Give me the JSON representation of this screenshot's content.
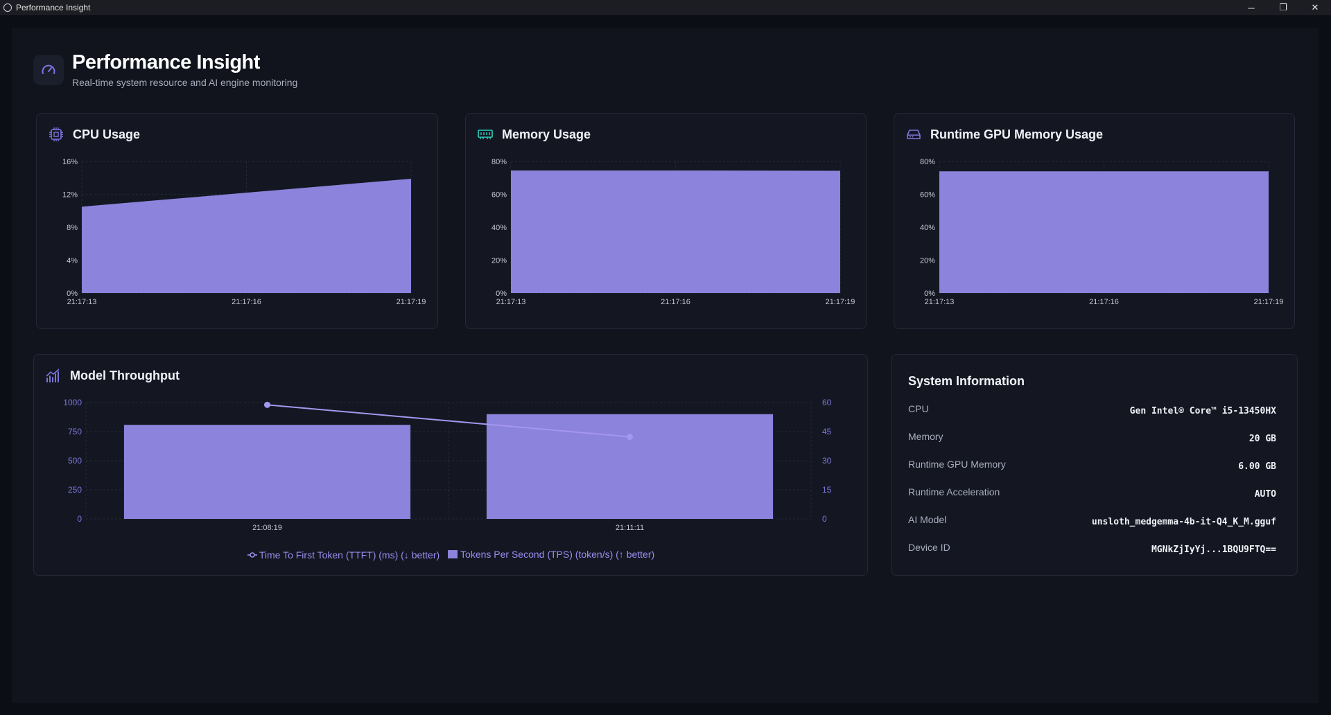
{
  "window": {
    "title": "Performance Insight",
    "minimize": "─",
    "restore": "❐",
    "close": "✕"
  },
  "header": {
    "title": "Performance Insight",
    "subtitle": "Real-time system resource and AI engine monitoring",
    "icon": "gauge-icon"
  },
  "colors": {
    "accent": "#8b83dc",
    "line": "#a596f0",
    "axis_text": "#c6c8d4",
    "right_axis_text": "#7f74e0"
  },
  "cards": {
    "cpu": {
      "title": "CPU Usage",
      "icon": "cpu-icon"
    },
    "memory": {
      "title": "Memory Usage",
      "icon": "memory-icon"
    },
    "gpu": {
      "title": "Runtime GPU Memory Usage",
      "icon": "gpu-memory-icon"
    },
    "throughput": {
      "title": "Model Throughput",
      "icon": "throughput-chart-icon"
    }
  },
  "chart_data": [
    {
      "type": "area",
      "id": "cpu",
      "x": [
        "21:17:13",
        "21:17:16",
        "21:17:19"
      ],
      "values": [
        10.5,
        12.2,
        13.9
      ],
      "ylim": [
        0,
        16
      ],
      "yticks": [
        "0%",
        "4%",
        "8%",
        "12%",
        "16%"
      ],
      "ytick_values": [
        0,
        4,
        8,
        12,
        16
      ],
      "grid": true
    },
    {
      "type": "area",
      "id": "memory",
      "x": [
        "21:17:13",
        "21:17:16",
        "21:17:19"
      ],
      "values": [
        74.5,
        74.5,
        74.3
      ],
      "ylim": [
        0,
        80
      ],
      "yticks": [
        "0%",
        "20%",
        "40%",
        "60%",
        "80%"
      ],
      "ytick_values": [
        0,
        20,
        40,
        60,
        80
      ],
      "grid": true
    },
    {
      "type": "area",
      "id": "gpu",
      "x": [
        "21:17:13",
        "21:17:16",
        "21:17:19"
      ],
      "values": [
        74,
        74,
        74
      ],
      "ylim": [
        0,
        80
      ],
      "yticks": [
        "0%",
        "20%",
        "40%",
        "60%",
        "80%"
      ],
      "ytick_values": [
        0,
        20,
        40,
        60,
        80
      ],
      "grid": true
    },
    {
      "type": "bar",
      "id": "throughput",
      "categories": [
        "21:08:19",
        "21:11:11"
      ],
      "series": [
        {
          "name": "Tokens Per Second (TPS) (token/s) (↑ better)",
          "kind": "bar",
          "axis": "right",
          "values": [
            48.5,
            54
          ]
        },
        {
          "name": "Time To First Token (TTFT) (ms) (↓ better)",
          "kind": "line",
          "axis": "left",
          "values": [
            980,
            705
          ]
        }
      ],
      "ylim_left": [
        0,
        1000
      ],
      "yticks_left": [
        "0",
        "250",
        "500",
        "750",
        "1000"
      ],
      "ytick_values_left": [
        0,
        250,
        500,
        750,
        1000
      ],
      "ylim_right": [
        0,
        60
      ],
      "yticks_right": [
        "0",
        "15",
        "30",
        "45",
        "60"
      ],
      "ytick_values_right": [
        0,
        15,
        30,
        45,
        60
      ],
      "legend": "bottom"
    }
  ],
  "system_info": {
    "title": "System Information",
    "rows": [
      {
        "label": "CPU",
        "value": "Gen Intel® Core™ i5-13450HX"
      },
      {
        "label": "Memory",
        "value": "20 GB"
      },
      {
        "label": "Runtime GPU Memory",
        "value": "6.00 GB"
      },
      {
        "label": "Runtime Acceleration",
        "value": "AUTO"
      },
      {
        "label": "AI Model",
        "value": "unsloth_medgemma-4b-it-Q4_K_M.gguf"
      },
      {
        "label": "Device ID",
        "value": "MGNkZjIyYj...1BQU9FTQ=="
      }
    ]
  }
}
